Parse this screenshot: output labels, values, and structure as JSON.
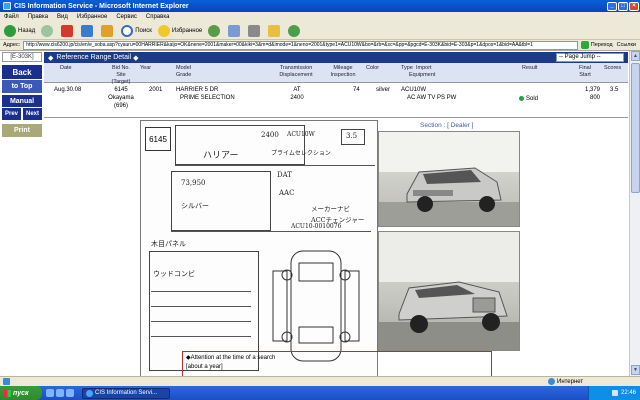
{
  "window": {
    "title": "CIS Information Service - Microsoft Internet Explorer"
  },
  "menu": [
    "Файл",
    "Правка",
    "Вид",
    "Избранное",
    "Сервис",
    "Справка"
  ],
  "toolbar": {
    "back_label": "Назад",
    "search_label": "Поиск",
    "favorites_label": "Избранное"
  },
  "address": {
    "label": "Адрес:",
    "url": "http://www.cis6200.jp/cis/en/e_soba.asp?cyauru=00HARRIER&kaijo=OK&nene=2001&maker=00&kiki=3&m=d&imode=1&neno=2001&type1=ACU10W&bo=&rb=&sc=&pp=&pgcd=E-303K&bid=E-303&p=1&dpos=1&bid=AA&tbl=1",
    "go_label": "Переход",
    "links_label": "Ссылки"
  },
  "nav": {
    "code": "[E-303K]",
    "back": "Back",
    "to_top": "to Top",
    "manual": "Manual",
    "prev": "Prev",
    "next": "Next",
    "print": "Print"
  },
  "refbar": {
    "title": "Reference Range Detail",
    "page_jump": "-- Page Jump --"
  },
  "columns": {
    "date": "Date",
    "bid_no": "Bid No.",
    "site": "Site",
    "target": "(Target)",
    "year": "Year",
    "model": "Model",
    "grade": "Grade",
    "transmission": "Transmission",
    "displacement": "Displacement",
    "mileage": "Mileage",
    "inspection": "Inspection",
    "color": "Color",
    "type": "Type",
    "import": "Import",
    "equipment": "Equipment",
    "result": "Result",
    "final": "Final",
    "start": "Start",
    "scores": "Scores"
  },
  "row": {
    "date": "Aug.30.08",
    "bid_no": "6145",
    "site": "Okayama",
    "target": "(696)",
    "year": "2001",
    "model": "HARRIER 5 DR",
    "grade": "PRIME SELECTION",
    "transmission": "AT",
    "displacement": "2400",
    "mileage": "74",
    "color": "silver",
    "type": "ACU10W",
    "equipment": "AC AW TV PS PW",
    "result": "Sold",
    "final": "1,379",
    "start": "800",
    "score": "3.5"
  },
  "sheet": {
    "lot": "6145",
    "h1": "ハリアー",
    "h2": "2400",
    "h3": "ACU10W",
    "h4": "プライムセレクション",
    "h5": "3.5",
    "h6": "DAT",
    "h7": "73,950",
    "h8": "シルバー",
    "h9": "AAC",
    "h10": "メーカーナビ",
    "h11": "ACCチェンジャー",
    "h12": "ACU10-0010076",
    "h13": "木目パネル",
    "h14": "ウッドコンビ"
  },
  "section_label": "Section : [ Dealer ]",
  "attention": {
    "line1": "Attention at the time of a search",
    "line2": "[about a year]"
  },
  "status": {
    "zone": "Интернет"
  },
  "taskbar": {
    "start": "пуск",
    "task": "CIS Information Servi...",
    "clock": "22:46"
  },
  "colors": {
    "header_blue": "#1c3a8a",
    "nav_blue": "#1b2f8f",
    "sold_green": "#21a34b"
  }
}
